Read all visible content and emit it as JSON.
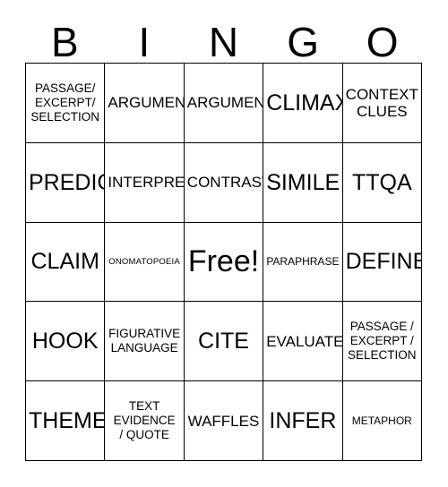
{
  "card": {
    "header_letters": [
      "B",
      "I",
      "N",
      "G",
      "O"
    ],
    "rows": [
      [
        {
          "text": "PASSAGE/\nEXCERPT/\nSELECTION",
          "size": "sz-sm"
        },
        {
          "text": "ARGUMENT",
          "size": "sz-md"
        },
        {
          "text": "ARGUMENT",
          "size": "sz-md"
        },
        {
          "text": "CLIMAX",
          "size": "sz-lg"
        },
        {
          "text": "CONTEXT\nCLUES",
          "size": "sz-md"
        }
      ],
      [
        {
          "text": "PREDICT",
          "size": "sz-lg"
        },
        {
          "text": "INTERPRET",
          "size": "sz-md"
        },
        {
          "text": "CONTRAST",
          "size": "sz-md"
        },
        {
          "text": "SIMILE",
          "size": "sz-lg"
        },
        {
          "text": "TTQA",
          "size": "sz-lg"
        }
      ],
      [
        {
          "text": "CLAIM",
          "size": "sz-lg"
        },
        {
          "text": "ONOMATOPOEIA",
          "size": "sz-xxs"
        },
        {
          "text": "Free!",
          "size": "sz-xl"
        },
        {
          "text": "PARAPHRASE",
          "size": "sz-xs"
        },
        {
          "text": "DEFINE",
          "size": "sz-lg"
        }
      ],
      [
        {
          "text": "HOOK",
          "size": "sz-lg"
        },
        {
          "text": "FIGURATIVE\nLANGUAGE",
          "size": "sz-sm"
        },
        {
          "text": "CITE",
          "size": "sz-lg"
        },
        {
          "text": "EVALUATE",
          "size": "sz-md"
        },
        {
          "text": "PASSAGE /\nEXCERPT /\nSELECTION",
          "size": "sz-sm"
        }
      ],
      [
        {
          "text": "THEME",
          "size": "sz-lg"
        },
        {
          "text": "TEXT\nEVIDENCE\n/ QUOTE",
          "size": "sz-sm"
        },
        {
          "text": "WAFFLES",
          "size": "sz-md"
        },
        {
          "text": "INFER",
          "size": "sz-lg"
        },
        {
          "text": "METAPHOR",
          "size": "sz-xs"
        }
      ]
    ],
    "colors": {
      "background": "#ffffff",
      "text": "#000000",
      "grid_line": "#000000"
    }
  }
}
